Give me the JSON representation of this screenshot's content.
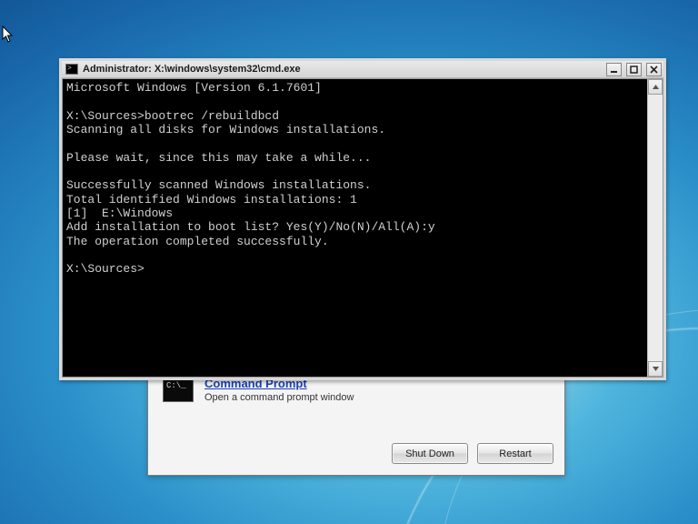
{
  "cmd": {
    "title": "Administrator: X:\\windows\\system32\\cmd.exe",
    "lines": [
      "Microsoft Windows [Version 6.1.7601]",
      "",
      "X:\\Sources>bootrec /rebuildbcd",
      "Scanning all disks for Windows installations.",
      "",
      "Please wait, since this may take a while...",
      "",
      "Successfully scanned Windows installations.",
      "Total identified Windows installations: 1",
      "[1]  E:\\Windows",
      "Add installation to boot list? Yes(Y)/No(N)/All(A):y",
      "The operation completed successfully.",
      "",
      "X:\\Sources>"
    ]
  },
  "recovery": {
    "link": "Command Prompt",
    "desc": "Open a command prompt window",
    "shutdown": "Shut Down",
    "restart": "Restart"
  }
}
